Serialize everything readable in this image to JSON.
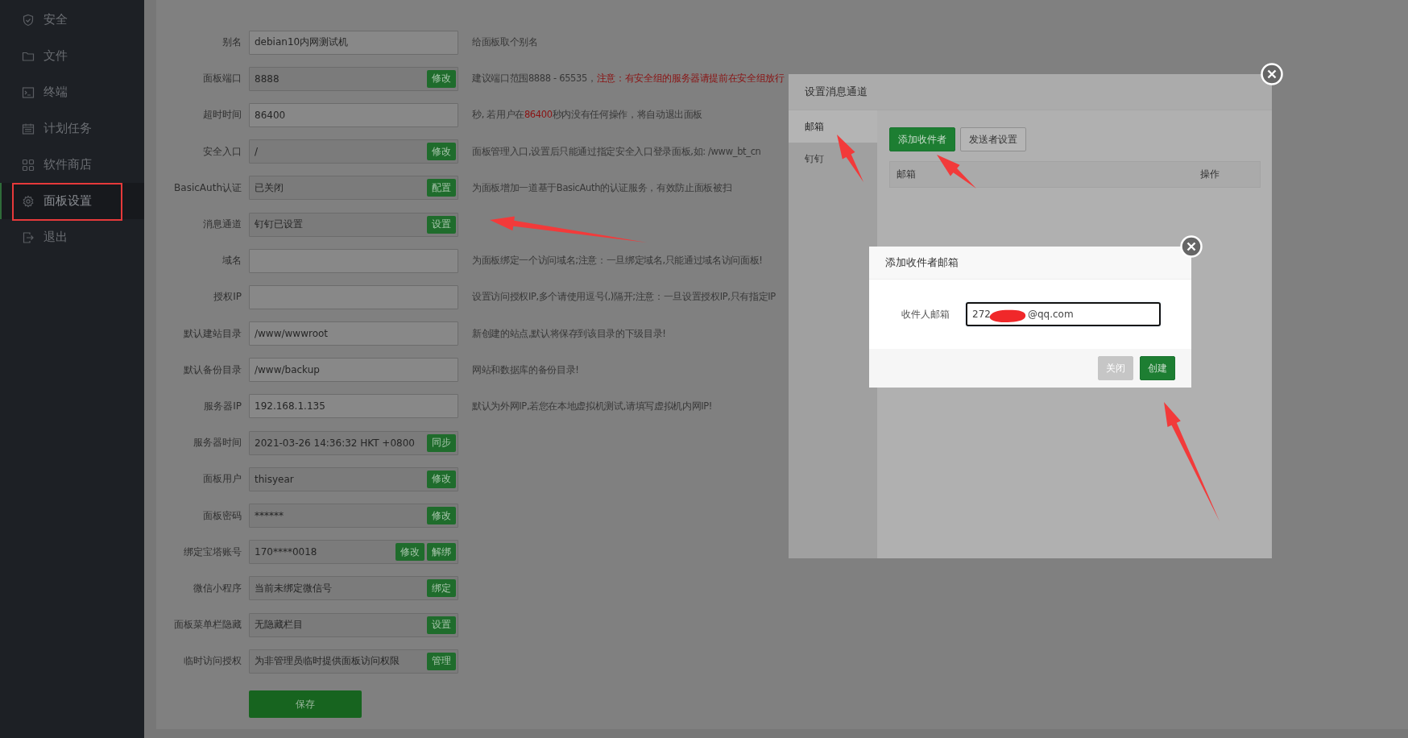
{
  "sidebar": {
    "items": [
      {
        "label": "安全",
        "selected": false
      },
      {
        "label": "文件",
        "selected": false
      },
      {
        "label": "终端",
        "selected": false
      },
      {
        "label": "计划任务",
        "selected": false
      },
      {
        "label": "软件商店",
        "selected": false
      },
      {
        "label": "面板设置",
        "selected": true,
        "highlighted": true
      },
      {
        "label": "退出",
        "selected": false
      }
    ]
  },
  "form": {
    "rows": [
      {
        "label": "别名",
        "value": "debian10内网测试机",
        "readonly": false,
        "hint": [
          {
            "text": "给面板取个别名",
            "emphasis": false
          }
        ]
      },
      {
        "label": "面板端口",
        "value": "8888",
        "readonly": true,
        "buttons": [
          "修改"
        ],
        "hint": [
          {
            "text": "建议端口范围8888 - 65535，",
            "emphasis": false
          },
          {
            "text": "注意：有安全组的服务器请提前在安全组放行",
            "emphasis": true
          }
        ]
      },
      {
        "label": "超时时间",
        "value": "86400",
        "readonly": false,
        "hint": [
          {
            "text": "秒, 若用户在",
            "emphasis": false
          },
          {
            "text": "86400",
            "emphasis": true
          },
          {
            "text": "秒内没有任何操作，将自动退出面板",
            "emphasis": false
          }
        ]
      },
      {
        "label": "安全入口",
        "value": "/",
        "readonly": true,
        "buttons": [
          "修改"
        ],
        "hint": [
          {
            "text": "面板管理入口,设置后只能通过指定安全入口登录面板,如: /www_bt_cn",
            "emphasis": false
          }
        ]
      },
      {
        "label": "BasicAuth认证",
        "value": "已关闭",
        "readonly": true,
        "buttons": [
          "配置"
        ],
        "hint": [
          {
            "text": "为面板增加一道基于BasicAuth的认证服务，有效防止面板被扫",
            "emphasis": false
          }
        ]
      },
      {
        "label": "消息通道",
        "value": "钉钉已设置",
        "readonly": true,
        "buttons": [
          "设置"
        ]
      },
      {
        "label": "域名",
        "readonly": false,
        "hint": [
          {
            "text": "为面板绑定一个访问域名;注意：一旦绑定域名,只能通过域名访问面板!",
            "emphasis": false
          }
        ]
      },
      {
        "label": "授权IP",
        "readonly": false,
        "hint": [
          {
            "text": "设置访问授权IP,多个请使用逗号(,)隔开;注意：一旦设置授权IP,只有指定IP",
            "emphasis": false
          }
        ]
      },
      {
        "label": "默认建站目录",
        "value": "/www/wwwroot",
        "readonly": false,
        "hint": [
          {
            "text": "新创建的站点,默认将保存到该目录的下级目录!",
            "emphasis": false
          }
        ]
      },
      {
        "label": "默认备份目录",
        "value": "/www/backup",
        "readonly": false,
        "hint": [
          {
            "text": "网站和数据库的备份目录!",
            "emphasis": false
          }
        ]
      },
      {
        "label": "服务器IP",
        "value": "192.168.1.135",
        "readonly": false,
        "hint": [
          {
            "text": "默认为外网IP,若您在本地虚拟机测试,请填写虚拟机内网IP!",
            "emphasis": false
          }
        ]
      },
      {
        "label": "服务器时间",
        "value": "2021-03-26 14:36:32 HKT +0800",
        "readonly": true,
        "buttons": [
          "同步"
        ]
      },
      {
        "label": "面板用户",
        "value": "thisyear",
        "readonly": true,
        "buttons": [
          "修改"
        ]
      },
      {
        "label": "面板密码",
        "value": "******",
        "readonly": true,
        "buttons": [
          "修改"
        ]
      },
      {
        "label": "绑定宝塔账号",
        "value": "170****0018",
        "readonly": true,
        "buttons": [
          "修改",
          "解绑"
        ]
      },
      {
        "label": "微信小程序",
        "value": "当前未绑定微信号",
        "readonly": true,
        "buttons": [
          "绑定"
        ]
      },
      {
        "label": "面板菜单栏隐藏",
        "value": "无隐藏栏目",
        "readonly": true,
        "buttons": [
          "设置"
        ]
      },
      {
        "label": "临时访问授权",
        "value": "为非管理员临时提供面板访问权限",
        "readonly": true,
        "buttons": [
          "管理"
        ]
      }
    ],
    "save_button": "保存"
  },
  "channel_dialog": {
    "title": "设置消息通道",
    "tabs": [
      {
        "label": "邮箱",
        "selected": true
      },
      {
        "label": "钉钉",
        "selected": false
      }
    ],
    "buttons": [
      {
        "label": "添加收件者",
        "kind": "primary"
      },
      {
        "label": "发送者设置",
        "kind": "default"
      }
    ],
    "table": {
      "columns": [
        "邮箱",
        "操作"
      ]
    }
  },
  "recipient_dialog": {
    "title": "添加收件者邮箱",
    "field": {
      "label": "收件人邮箱",
      "value_parts": [
        "272",
        "@qq.com"
      ],
      "redacted": true
    },
    "buttons": [
      {
        "label": "关闭",
        "kind": "muted"
      },
      {
        "label": "创建",
        "kind": "primary"
      }
    ]
  }
}
